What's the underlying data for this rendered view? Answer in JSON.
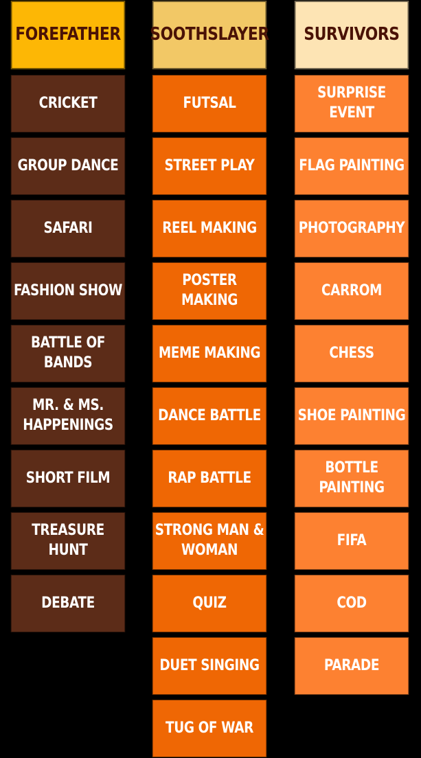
{
  "columns": [
    {
      "header": "FOREFATHER",
      "items": [
        "CRICKET",
        "GROUP DANCE",
        "SAFARI",
        "FASHION SHOW",
        "BATTLE OF BANDS",
        "MR. &  MS.\nHAPPENINGS",
        "SHORT FILM",
        "TREASURE HUNT",
        "DEBATE"
      ]
    },
    {
      "header": "SOOTHSLAYER",
      "items": [
        "FUTSAL",
        "STREET PLAY",
        "REEL MAKING",
        "POSTER MAKING",
        "MEME MAKING",
        "DANCE BATTLE",
        "RAP BATTLE",
        "STRONG MAN &\nWOMAN",
        "QUIZ",
        "DUET SINGING",
        "TUG OF WAR"
      ]
    },
    {
      "header": "SURVIVORS",
      "items": [
        "SURPRISE EVENT",
        "FLAG PAINTING",
        "PHOTOGRAPHY",
        "CARROM",
        "CHESS",
        "SHOE PAINTING",
        "BOTTLE PAINTING",
        "FIFA",
        "COD",
        "PARADE"
      ]
    }
  ],
  "colors": {
    "forefather_header": "#fdb705",
    "soothslayer_header": "#f2c866",
    "survivors_header": "#fde4b4",
    "forefather_cell": "#5c2c18",
    "soothslayer_cell": "#ef6704",
    "survivors_cell": "#fd8131",
    "header_text": "#4a1206",
    "cell_text": "#ffffff",
    "background": "#000000"
  }
}
